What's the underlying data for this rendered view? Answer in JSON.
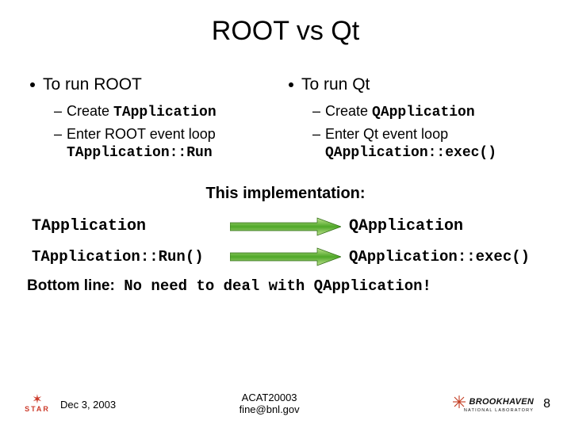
{
  "title": "ROOT vs Qt",
  "left": {
    "heading": "To run ROOT",
    "item1_pre": "Create ",
    "item1_code": "TApplication",
    "item2_pre": "Enter ROOT event loop",
    "item2_code": "TApplication::Run"
  },
  "right": {
    "heading": "To run Qt",
    "item1_pre": "Create ",
    "item1_code": "QApplication",
    "item2_pre": "Enter Qt event loop",
    "item2_code": "QApplication::exec()"
  },
  "impl_label": "This implementation:",
  "map": {
    "row1_left": "TApplication",
    "row1_right": "QApplication",
    "row2_left": "TApplication::Run()",
    "row2_right": "QApplication::exec()"
  },
  "bottom": {
    "lead": "Bottom line:",
    "rest_a": " No need to deal with ",
    "rest_b": "QApplication",
    "rest_c": "!"
  },
  "footer": {
    "date": "Dec 3, 2003",
    "conf": "ACAT20003",
    "email": "fine@bnl.gov",
    "star": "STAR",
    "bnl_top": "BROOKHAVEN",
    "bnl_sub": "NATIONAL LABORATORY",
    "page": "8"
  }
}
